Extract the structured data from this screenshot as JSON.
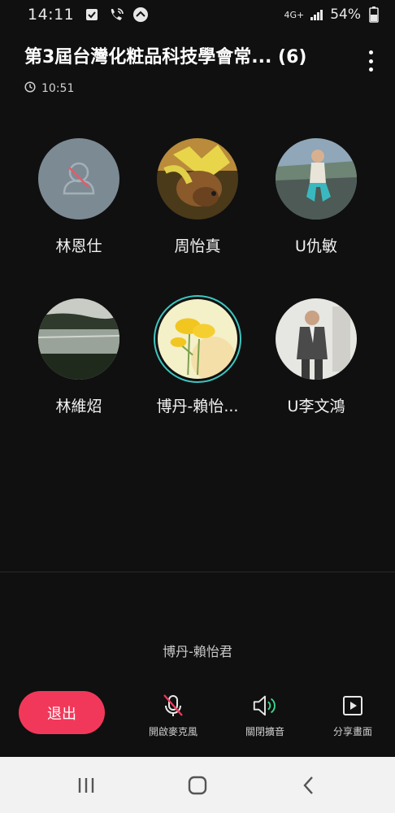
{
  "status_bar": {
    "time": "14:11",
    "network": "4G+",
    "battery": "54%"
  },
  "header": {
    "title": "第3屆台灣化粧品科技學會常... (6)",
    "duration": "10:51"
  },
  "participants": [
    {
      "name": "林恩仕",
      "avatar": "default-muted"
    },
    {
      "name": "周怡真",
      "avatar": "dog-photo"
    },
    {
      "name": "U仇敏",
      "avatar": "person-photo"
    },
    {
      "name": "林維炤",
      "avatar": "lake-photo"
    },
    {
      "name": "博丹-賴怡...",
      "avatar": "flower-illustration",
      "speaking": true
    },
    {
      "name": "U李文鴻",
      "avatar": "man-photo"
    }
  ],
  "current_speaker": "博丹-賴怡君",
  "controls": {
    "exit_label": "退出",
    "mic_label": "開啟麥克風",
    "speaker_label": "關閉擴音",
    "share_label": "分享畫面"
  },
  "colors": {
    "accent_red": "#f2385a",
    "speaking_ring": "#3ec6c1",
    "speaker_green": "#3dd68c"
  }
}
